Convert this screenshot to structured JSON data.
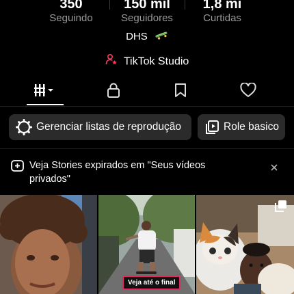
{
  "stats": [
    {
      "value": "350",
      "label": "Seguindo"
    },
    {
      "value": "150 mil",
      "label": "Seguidores"
    },
    {
      "value": "1,8 mi",
      "label": "Curtidas"
    }
  ],
  "bio": {
    "text": "DHS",
    "emoji_icon": "skateboard-icon"
  },
  "studio": {
    "label": "TikTok Studio",
    "icon": "person-star-icon"
  },
  "tabs": [
    {
      "name": "videos-grid-icon",
      "active": true
    },
    {
      "name": "lock-icon",
      "active": false
    },
    {
      "name": "bookmark-icon",
      "active": false
    },
    {
      "name": "heart-icon",
      "active": false
    }
  ],
  "actions": {
    "manage_playlists": "Gerenciar listas de reprodução",
    "role_basico": "Role basico"
  },
  "notice": {
    "text": "Veja Stories expirados em \"Seus vídeos privados\""
  },
  "videos": [
    {
      "badge": ""
    },
    {
      "badge": "Veja até o final"
    },
    {
      "badge": ""
    }
  ],
  "colors": {
    "accent": "#e8265e",
    "button_bg": "#2b2b2b",
    "muted": "#9a9a9a"
  }
}
